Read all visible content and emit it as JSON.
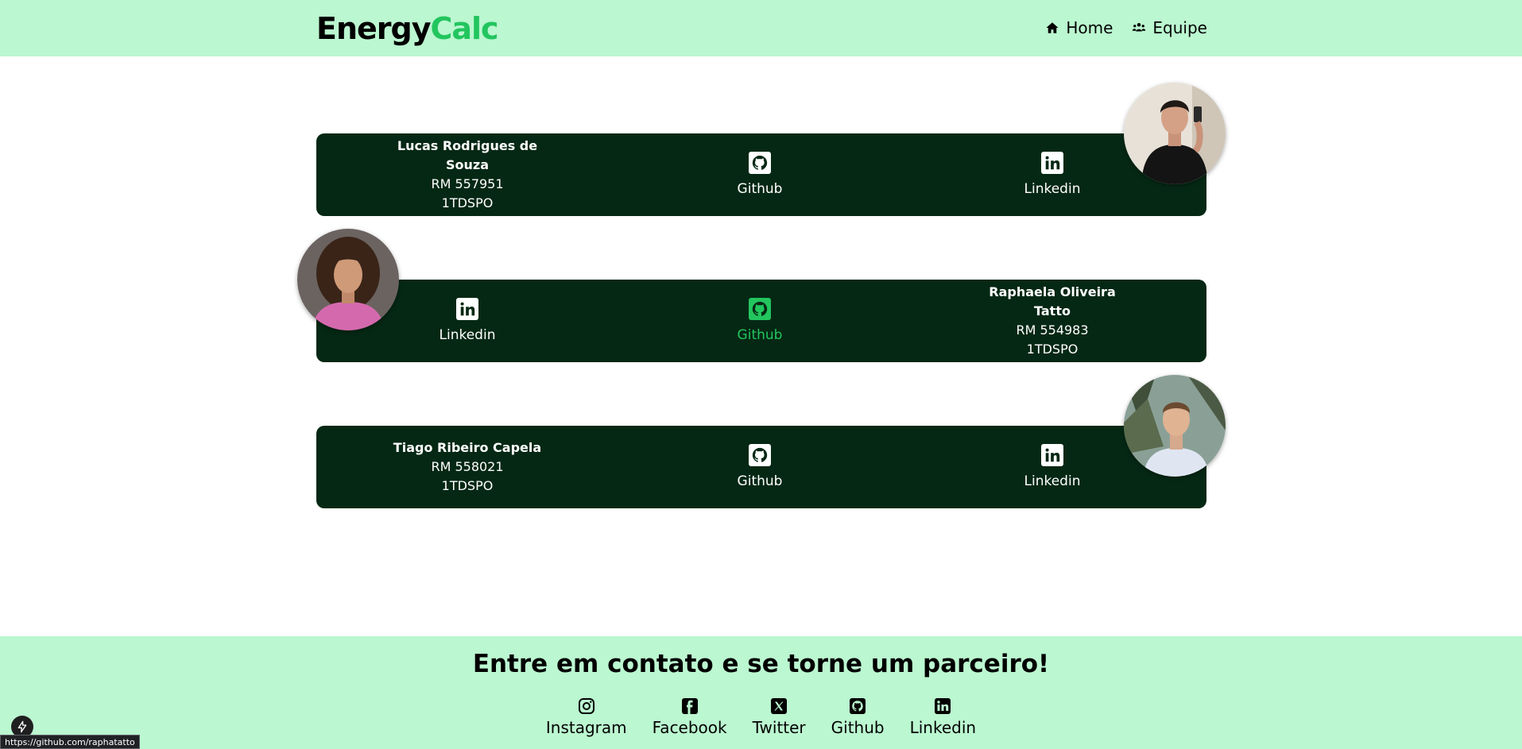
{
  "header": {
    "logo_part1": "Energy",
    "logo_part2": "Calc",
    "nav": [
      {
        "label": "Home",
        "icon": "home-icon"
      },
      {
        "label": "Equipe",
        "icon": "people-group-icon"
      }
    ]
  },
  "members": [
    {
      "name": "Lucas Rodrigues de Souza",
      "rm": "RM 557951",
      "class": "1TDSPO",
      "github_label": "Github",
      "linkedin_label": "Linkedin"
    },
    {
      "name": "Raphaela Oliveira Tatto",
      "rm": "RM 554983",
      "class": "1TDSPO",
      "github_label": "Github",
      "linkedin_label": "Linkedin"
    },
    {
      "name": "Tiago Ribeiro Capela",
      "rm": "RM 558021",
      "class": "1TDSPO",
      "github_label": "Github",
      "linkedin_label": "Linkedin"
    }
  ],
  "footer": {
    "title": "Entre em contato e se torne um parceiro!",
    "links": [
      {
        "label": "Instagram",
        "icon": "instagram-icon"
      },
      {
        "label": "Facebook",
        "icon": "facebook-icon"
      },
      {
        "label": "Twitter",
        "icon": "x-twitter-icon"
      },
      {
        "label": "Github",
        "icon": "github-icon"
      },
      {
        "label": "Linkedin",
        "icon": "linkedin-icon"
      }
    ]
  },
  "status_url": "https://github.com/raphatatto",
  "colors": {
    "header_bg": "#bbf7d0",
    "card_bg": "#052814",
    "accent": "#22c55e"
  }
}
